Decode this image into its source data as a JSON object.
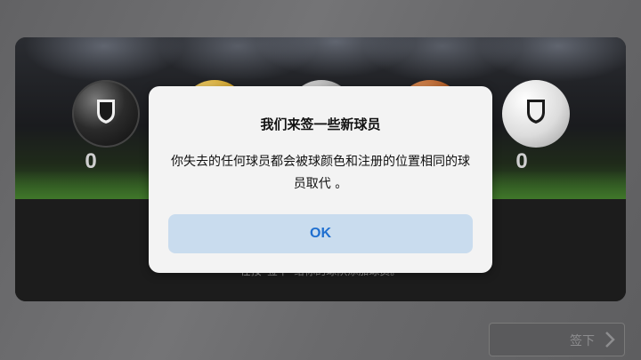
{
  "dialog": {
    "title": "我们来签一些新球员",
    "message": "你失去的任何球员都会被球颜色和注册的位置相同的球员取代 。",
    "ok_label": "OK"
  },
  "stage": {
    "balls": [
      {
        "kind": "black-ball"
      },
      {
        "kind": "gold-ball"
      },
      {
        "kind": "silver-ball"
      },
      {
        "kind": "bronze-ball"
      },
      {
        "kind": "white-ball"
      }
    ],
    "left_count": "0",
    "right_count": "0",
    "hint_text": "在按“签下”给你的球队添加球员。"
  },
  "footer": {
    "sign_label": "签下",
    "sign_icon": "chevron-right-icon"
  },
  "colors": {
    "ok_text": "#1f6fd0",
    "ok_bg": "#c9dcee",
    "dialog_bg": "#f3f3f3"
  }
}
